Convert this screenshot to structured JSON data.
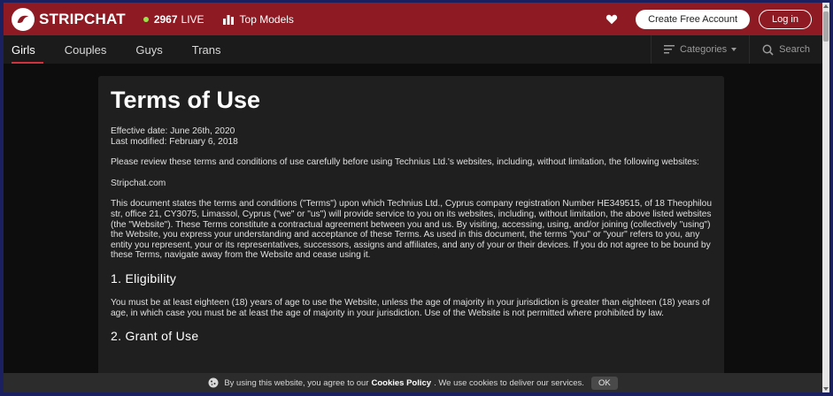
{
  "header": {
    "brand": "STRIPCHAT",
    "live_count": "2967",
    "live_label": "LIVE",
    "top_models": "Top Models",
    "create_account": "Create Free Account",
    "login": "Log in"
  },
  "nav": {
    "tabs": [
      "Girls",
      "Couples",
      "Guys",
      "Trans"
    ],
    "categories": "Categories",
    "search": "Search"
  },
  "doc": {
    "title": "Terms of Use",
    "effective": "Effective date: June 26th, 2020",
    "modified": "Last modified: February 6, 2018",
    "intro": "Please review these terms and conditions of use carefully before using Technius Ltd.'s websites, including, without limitation, the following websites:",
    "site": "Stripchat.com",
    "body": "This document states the terms and conditions (\"Terms\") upon which Technius Ltd., Cyprus company registration Number HE349515, of 18 Theophilou str, office 21, CY3075, Limassol, Cyprus (\"we\" or \"us\") will provide service to you on its websites, including, without limitation, the above listed websites (the \"Website\"). These Terms constitute a contractual agreement between you and us. By visiting, accessing, using, and/or joining (collectively \"using\") the Website, you express your understanding and acceptance of these Terms. As used in this document, the terms \"you\" or \"your\" refers to you, any entity you represent, your or its representatives, successors, assigns and affiliates, and any of your or their devices. If you do not agree to be bound by these Terms, navigate away from the Website and cease using it.",
    "h_eligibility": "1. Eligibility",
    "eligibility": "You must be at least eighteen (18) years of age to use the Website, unless the age of majority in your jurisdiction is greater than eighteen (18) years of age, in which case you must be at least the age of majority in your jurisdiction. Use of the Website is not permitted where prohibited by law.",
    "h_grant": "2. Grant of Use"
  },
  "cookie": {
    "before": "By using this website, you agree to our",
    "link": "Cookies Policy",
    "after": ". We use cookies to deliver our services.",
    "ok": "OK"
  },
  "colors": {
    "header_bg": "#8e1b23",
    "accent": "#d1333d",
    "live_dot": "#9be34a"
  }
}
